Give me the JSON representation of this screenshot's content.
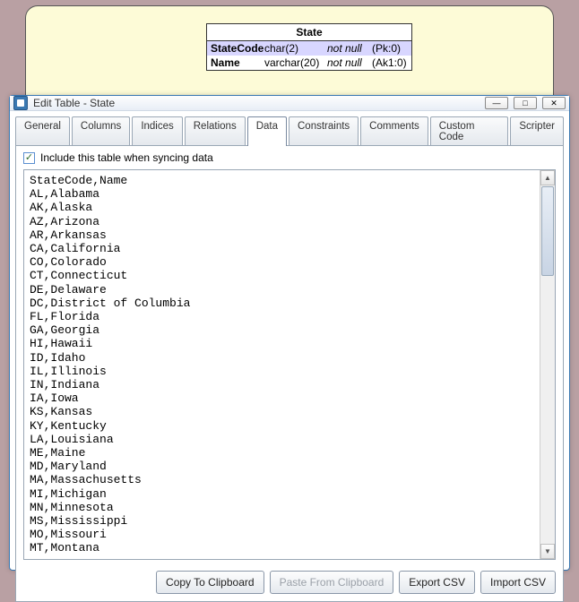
{
  "entity": {
    "title": "State",
    "rows": [
      {
        "name": "StateCode",
        "type": "char(2)",
        "null": "not null",
        "key": "(Pk:0)"
      },
      {
        "name": "Name",
        "type": "varchar(20)",
        "null": "not null",
        "key": "(Ak1:0)"
      }
    ]
  },
  "window": {
    "title": "Edit Table - State",
    "tabs": [
      "General",
      "Columns",
      "Indices",
      "Relations",
      "Data",
      "Constraints",
      "Comments",
      "Custom Code",
      "Scripter"
    ],
    "active_tab": "Data",
    "checkbox_label": "Include this table when syncing data",
    "checkbox_checked": true,
    "footer": {
      "copy": "Copy To Clipboard",
      "paste": "Paste From Clipboard",
      "export": "Export CSV",
      "import": "Import CSV"
    }
  },
  "csv_header": "StateCode,Name",
  "csv_rows": [
    "AL,Alabama",
    "AK,Alaska",
    "AZ,Arizona",
    "AR,Arkansas",
    "CA,California",
    "CO,Colorado",
    "CT,Connecticut",
    "DE,Delaware",
    "DC,District of Columbia",
    "FL,Florida",
    "GA,Georgia",
    "HI,Hawaii",
    "ID,Idaho",
    "IL,Illinois",
    "IN,Indiana",
    "IA,Iowa",
    "KS,Kansas",
    "KY,Kentucky",
    "LA,Louisiana",
    "ME,Maine",
    "MD,Maryland",
    "MA,Massachusetts",
    "MI,Michigan",
    "MN,Minnesota",
    "MS,Mississippi",
    "MO,Missouri",
    "MT,Montana"
  ]
}
